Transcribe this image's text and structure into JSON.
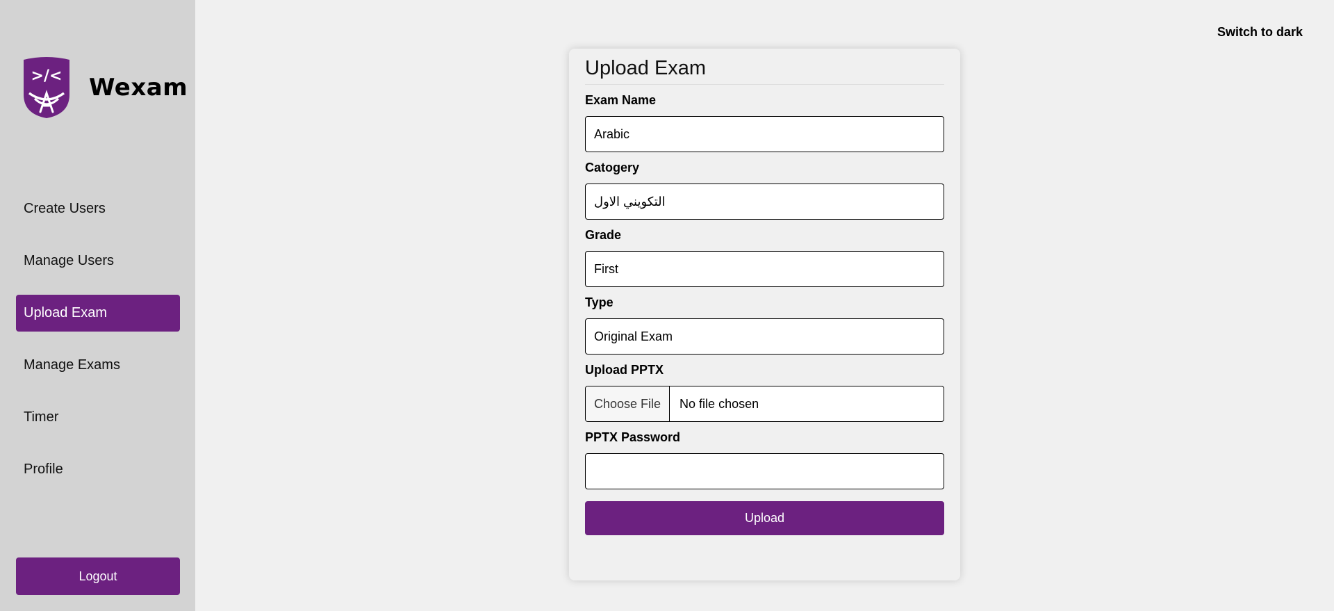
{
  "app": {
    "brand_name": "Wexam",
    "logo_text": ">/<",
    "accent_color": "#6c2180"
  },
  "sidebar": {
    "items": [
      {
        "label": "Create Users",
        "active": false
      },
      {
        "label": "Manage Users",
        "active": false
      },
      {
        "label": "Upload Exam",
        "active": true
      },
      {
        "label": "Manage Exams",
        "active": false
      },
      {
        "label": "Timer",
        "active": false
      },
      {
        "label": "Profile",
        "active": false
      }
    ],
    "logout_label": "Logout"
  },
  "header": {
    "theme_toggle_label": "Switch to dark"
  },
  "form": {
    "title": "Upload Exam",
    "exam_name": {
      "label": "Exam Name",
      "value": "Arabic"
    },
    "category": {
      "label": "Catogery",
      "value": "التكويني الاول"
    },
    "grade": {
      "label": "Grade",
      "value": "First"
    },
    "type": {
      "label": "Type",
      "value": "Original Exam"
    },
    "file": {
      "label": "Upload PPTX",
      "button_label": "Choose File",
      "status": "No file chosen"
    },
    "password": {
      "label": "PPTX Password",
      "value": ""
    },
    "submit_label": "Upload"
  }
}
